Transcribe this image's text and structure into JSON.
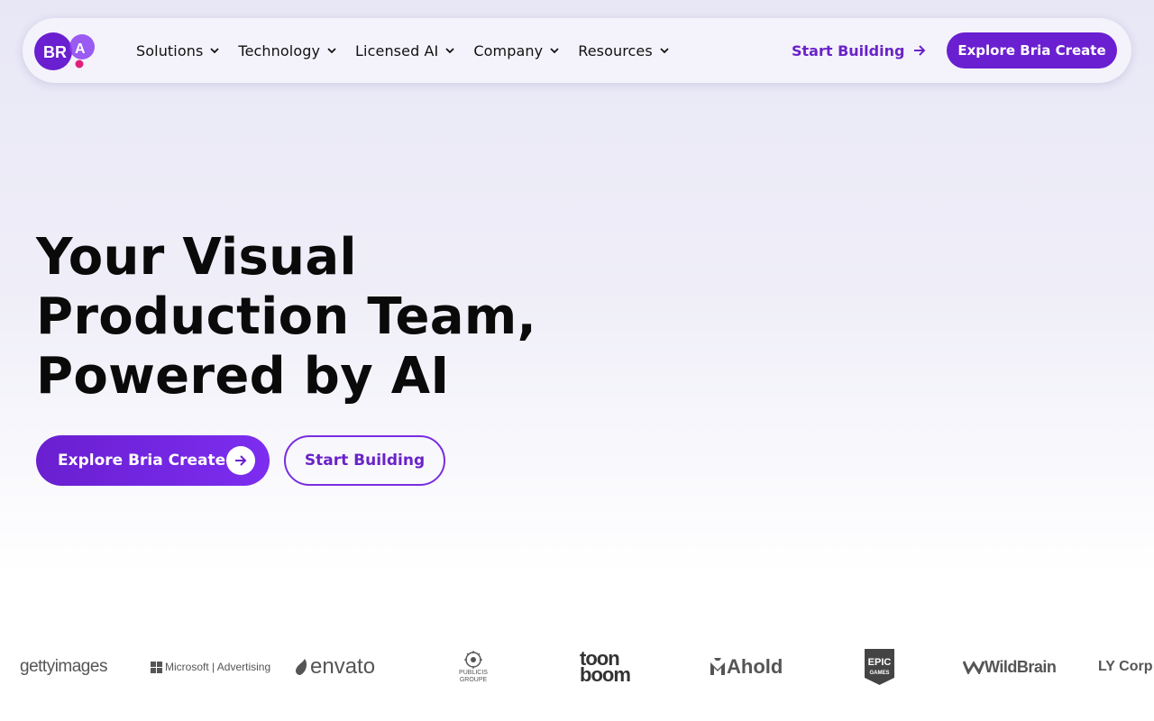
{
  "brand": {
    "logo_text": "BRIA",
    "accent": "#6a1fd0",
    "accent_dot": "#e0207a"
  },
  "nav": {
    "items": [
      {
        "label": "Solutions"
      },
      {
        "label": "Technology"
      },
      {
        "label": "Licensed AI"
      },
      {
        "label": "Company"
      },
      {
        "label": "Resources"
      }
    ],
    "start_building": "Start Building",
    "explore": "Explore Bria Create"
  },
  "hero": {
    "title_lines": [
      "Your Visual",
      "Production Team,",
      "Powered by AI"
    ],
    "primary_cta": "Explore Bria Create",
    "secondary_cta": "Start Building"
  },
  "logos": {
    "getty": "gettyimages",
    "microsoft": "Microsoft | Advertising",
    "envato": "envato",
    "publicis_line1": "PUBLICIS",
    "publicis_line2": "GROUPE",
    "toonboom_line1": "toon",
    "toonboom_line2": "boom",
    "ahold": "Ahold",
    "epic_line1": "EPIC",
    "epic_line2": "GAMES",
    "wildbrain": "WildBrain",
    "ly": "LY Corp"
  }
}
